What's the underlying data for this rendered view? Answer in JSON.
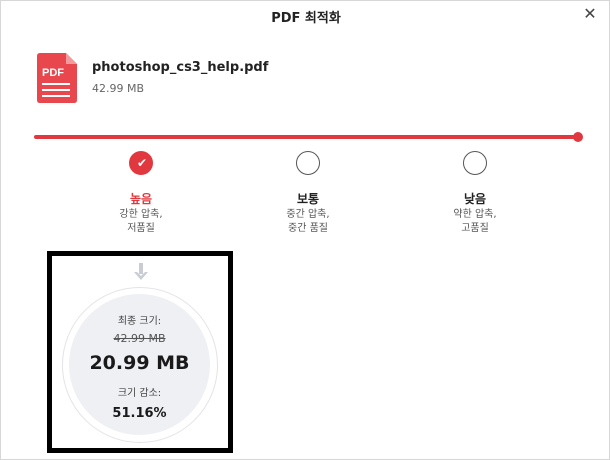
{
  "window": {
    "title": "PDF 최적화",
    "close_glyph": "✕"
  },
  "file": {
    "icon": "pdf-file-icon",
    "icon_text": "PDF",
    "name": "photoshop_cs3_help.pdf",
    "size": "42.99 MB"
  },
  "compression": {
    "selected_index": 0,
    "accent_color": "#e0383e",
    "options": [
      {
        "label": "높음",
        "desc_line1": "강한 압축,",
        "desc_line2": "저품질"
      },
      {
        "label": "보통",
        "desc_line1": "중간 압축,",
        "desc_line2": "중간 품질"
      },
      {
        "label": "낮음",
        "desc_line1": "약한 압축,",
        "desc_line2": "고품질"
      }
    ]
  },
  "result": {
    "final_size_label": "최종 크기:",
    "original_size": "42.99 MB",
    "new_size": "20.99 MB",
    "reduction_label": "크기 감소:",
    "reduction_percent": "51.16%"
  }
}
